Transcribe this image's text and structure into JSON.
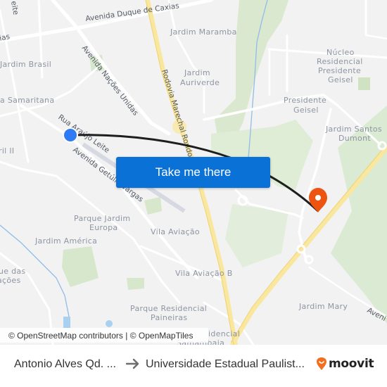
{
  "map": {
    "neighborhood_labels": [
      {
        "text": "Jardim Maramba"
      },
      {
        "text": "Jardim Brasil"
      },
      {
        "text": "Jardim"
      },
      {
        "text": "Auriverde"
      },
      {
        "text": "Núcleo"
      },
      {
        "text": "Residencial"
      },
      {
        "text": "Presidente"
      },
      {
        "text": "Geisel"
      },
      {
        "text": "Presidente"
      },
      {
        "text": "Geisel"
      },
      {
        "text": "a Samaritana"
      },
      {
        "text": "Jardim Santos"
      },
      {
        "text": "Dumont"
      },
      {
        "text": "ril II"
      },
      {
        "text": "Parque Jardim"
      },
      {
        "text": "Europa"
      },
      {
        "text": "Vila Aviação"
      },
      {
        "text": "Jardim América"
      },
      {
        "text": "ue das"
      },
      {
        "text": "ações"
      },
      {
        "text": "Vila Aviação B"
      },
      {
        "text": "Jardim Mary"
      },
      {
        "text": "Parque Residencial"
      },
      {
        "text": "Paineiras"
      },
      {
        "text": "idencial"
      },
      {
        "text": "Samambaia"
      }
    ],
    "road_labels": {
      "duque_de_caxias": "Avenida Duque de Caxias",
      "caxias_left": "ias",
      "leite_top": "eite",
      "nacoes_unidas": "Avenida Nações Unidas",
      "rodovia": "Rodovia Marechal Rondon",
      "rua_araujo_leite": "Rua Araújo Leite",
      "getulio_vargas": "Avenida Getúlio Vargas",
      "avenida_right": "Aveni"
    },
    "origin_marker": {
      "icon": "origin-dot-icon",
      "color": "#2f7bf5"
    },
    "destination_marker": {
      "icon": "map-pin-icon",
      "color": "#ee5411"
    },
    "route_color": "#1e1e1e",
    "take_me_there": "Take me there",
    "attribution": "© OpenStreetMap contributors | © OpenMapTiles"
  },
  "footer": {
    "origin": "Antonio Alves Qd. ...",
    "arrow_icon": "arrow-right-icon",
    "destination": "Universidade Estadual Paulist...",
    "brand": "moovit",
    "brand_color": "#f26f21"
  }
}
